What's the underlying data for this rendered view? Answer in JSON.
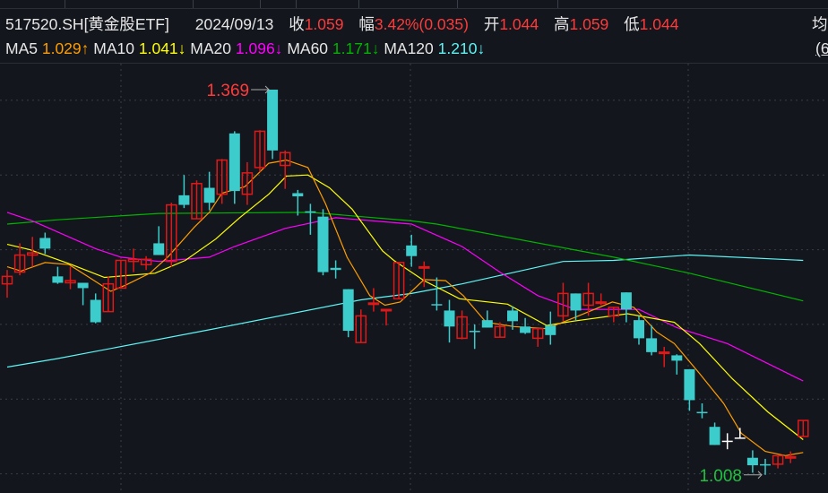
{
  "header": {
    "symbol": "517520.SH[黄金股ETF]",
    "date": "2024/09/13",
    "close_label": "收",
    "close_value": "1.059",
    "change_label": "幅",
    "change_value": "3.42%(0.035)",
    "open_label": "开",
    "open_value": "1.044",
    "high_label": "高",
    "high_value": "1.059",
    "low_label": "低",
    "low_value": "1.044",
    "avg_label_cut": "均",
    "right_cut": "(6"
  },
  "ma_legend": [
    {
      "name": "MA5",
      "value": "1.029↑",
      "color": "#ff9d00"
    },
    {
      "name": "MA10",
      "value": "1.041↓",
      "color": "#ffff00"
    },
    {
      "name": "MA20",
      "value": "1.096↓",
      "color": "#ff00ff"
    },
    {
      "name": "MA60",
      "value": "1.171↓",
      "color": "#00b400"
    },
    {
      "name": "MA120",
      "value": "1.210↓",
      "color": "#5ff5f5"
    }
  ],
  "colors": {
    "up": "#e01818",
    "down": "#3ccccc",
    "flat": "#ffffff",
    "background": "#13161c"
  },
  "chart_data": {
    "type": "candlestick",
    "title": "517520.SH 黄金股ETF daily",
    "ylim": [
      0.991,
      1.453
    ],
    "grid_prices": [
      1.359,
      1.289,
      1.219,
      1.149,
      1.079,
      1.009
    ],
    "annotations": [
      {
        "text": "1.369",
        "candle": 22,
        "price": 1.369,
        "kind": "high",
        "color": "#ff3a3a"
      },
      {
        "text": "1.008",
        "candle": 61,
        "price": 1.008,
        "kind": "low",
        "color": "#1fc040"
      }
    ],
    "candles": [
      [
        1.187,
        1.2,
        1.174,
        1.194
      ],
      [
        1.198,
        1.225,
        1.195,
        1.214
      ],
      [
        1.214,
        1.231,
        1.203,
        1.216
      ],
      [
        1.23,
        1.235,
        1.215,
        1.22
      ],
      [
        1.194,
        1.203,
        1.187,
        1.188
      ],
      [
        1.188,
        1.203,
        1.182,
        1.19
      ],
      [
        1.188,
        1.188,
        1.167,
        1.183
      ],
      [
        1.172,
        1.178,
        1.15,
        1.151
      ],
      [
        1.161,
        1.194,
        1.161,
        1.187
      ],
      [
        1.183,
        1.209,
        1.183,
        1.209
      ],
      [
        1.208,
        1.22,
        1.198,
        1.21
      ],
      [
        1.205,
        1.213,
        1.2,
        1.21
      ],
      [
        1.225,
        1.241,
        1.214,
        1.214
      ],
      [
        1.208,
        1.263,
        1.203,
        1.261
      ],
      [
        1.27,
        1.289,
        1.258,
        1.261
      ],
      [
        1.248,
        1.284,
        1.248,
        1.281
      ],
      [
        1.277,
        1.292,
        1.256,
        1.263
      ],
      [
        1.271,
        1.304,
        1.262,
        1.303
      ],
      [
        1.328,
        1.33,
        1.262,
        1.274
      ],
      [
        1.271,
        1.301,
        1.261,
        1.291
      ],
      [
        1.296,
        1.331,
        1.292,
        1.33
      ],
      [
        1.369,
        1.369,
        1.304,
        1.312
      ],
      [
        1.298,
        1.312,
        1.276,
        1.31
      ],
      [
        1.272,
        1.275,
        1.251,
        1.269
      ],
      [
        1.255,
        1.262,
        1.233,
        1.254
      ],
      [
        1.25,
        1.257,
        1.195,
        1.198
      ],
      [
        1.202,
        1.209,
        1.192,
        1.2
      ],
      [
        1.182,
        1.182,
        1.137,
        1.143
      ],
      [
        1.132,
        1.163,
        1.132,
        1.157
      ],
      [
        1.168,
        1.183,
        1.161,
        1.169
      ],
      [
        1.162,
        1.163,
        1.148,
        1.163
      ],
      [
        1.173,
        1.207,
        1.173,
        1.207
      ],
      [
        1.223,
        1.233,
        1.203,
        1.213
      ],
      [
        1.202,
        1.208,
        1.184,
        1.203
      ],
      [
        1.168,
        1.193,
        1.162,
        1.167
      ],
      [
        1.162,
        1.172,
        1.132,
        1.147
      ],
      [
        1.136,
        1.162,
        1.135,
        1.156
      ],
      [
        1.143,
        1.149,
        1.126,
        1.142
      ],
      [
        1.153,
        1.162,
        1.146,
        1.146
      ],
      [
        1.137,
        1.151,
        1.137,
        1.147
      ],
      [
        1.162,
        1.166,
        1.144,
        1.152
      ],
      [
        1.147,
        1.155,
        1.14,
        1.141
      ],
      [
        1.136,
        1.145,
        1.128,
        1.145
      ],
      [
        1.148,
        1.161,
        1.13,
        1.139
      ],
      [
        1.157,
        1.188,
        1.152,
        1.178
      ],
      [
        1.178,
        1.178,
        1.153,
        1.162
      ],
      [
        1.167,
        1.188,
        1.157,
        1.178
      ],
      [
        1.169,
        1.178,
        1.167,
        1.17
      ],
      [
        1.157,
        1.165,
        1.151,
        1.165
      ],
      [
        1.179,
        1.179,
        1.151,
        1.163
      ],
      [
        1.153,
        1.157,
        1.13,
        1.136
      ],
      [
        1.136,
        1.148,
        1.12,
        1.123
      ],
      [
        1.122,
        1.128,
        1.109,
        1.123
      ],
      [
        1.12,
        1.121,
        1.102,
        1.115
      ],
      [
        1.107,
        1.107,
        1.068,
        1.078
      ],
      [
        1.067,
        1.075,
        1.061,
        1.066
      ],
      [
        1.053,
        1.057,
        1.036,
        1.036
      ],
      [
        1.04,
        1.047,
        1.032,
        1.04
      ],
      [
        1.043,
        1.052,
        1.042,
        1.043
      ],
      [
        1.024,
        1.031,
        1.01,
        1.017
      ],
      [
        1.018,
        1.023,
        1.008,
        1.017
      ],
      [
        1.018,
        1.026,
        1.014,
        1.026
      ],
      [
        1.024,
        1.03,
        1.019,
        1.025
      ],
      [
        1.044,
        1.059,
        1.044,
        1.059
      ]
    ],
    "candle_fields": [
      "open",
      "high",
      "low",
      "close"
    ],
    "moving_averages": [
      {
        "name": "MA120",
        "color": "#5ff5f5",
        "points": [
          [
            1,
            1.109
          ],
          [
            5,
            1.117
          ],
          [
            17,
            1.144
          ],
          [
            29,
            1.172
          ],
          [
            33,
            1.178
          ],
          [
            37,
            1.187
          ],
          [
            45,
            1.208
          ],
          [
            49,
            1.209
          ],
          [
            55,
            1.214
          ],
          [
            64,
            1.209
          ]
        ]
      },
      {
        "name": "MA60",
        "color": "#00b400",
        "points": [
          [
            1,
            1.243
          ],
          [
            5,
            1.247
          ],
          [
            13,
            1.253
          ],
          [
            25,
            1.254
          ],
          [
            33,
            1.246
          ],
          [
            35,
            1.243
          ],
          [
            49,
            1.212
          ],
          [
            55,
            1.197
          ],
          [
            64,
            1.171
          ]
        ]
      },
      {
        "name": "MA20",
        "color": "#ff00ff",
        "points": [
          [
            1,
            1.254
          ],
          [
            3,
            1.246
          ],
          [
            8,
            1.22
          ],
          [
            10,
            1.212
          ],
          [
            13,
            1.208
          ],
          [
            17,
            1.212
          ],
          [
            19,
            1.222
          ],
          [
            23,
            1.239
          ],
          [
            27,
            1.249
          ],
          [
            33,
            1.243
          ],
          [
            37,
            1.222
          ],
          [
            40,
            1.198
          ],
          [
            43,
            1.176
          ],
          [
            46,
            1.163
          ],
          [
            51,
            1.163
          ],
          [
            54,
            1.146
          ],
          [
            58,
            1.131
          ],
          [
            64,
            1.096
          ]
        ]
      },
      {
        "name": "MA10",
        "color": "#ffff00",
        "points": [
          [
            1,
            1.224
          ],
          [
            2.8,
            1.219
          ],
          [
            6.1,
            1.205
          ],
          [
            8.7,
            1.193
          ],
          [
            12.7,
            1.197
          ],
          [
            15.1,
            1.209
          ],
          [
            17.5,
            1.229
          ],
          [
            19.4,
            1.249
          ],
          [
            21.7,
            1.271
          ],
          [
            23.1,
            1.288
          ],
          [
            24.8,
            1.289
          ],
          [
            26.5,
            1.277
          ],
          [
            28.3,
            1.257
          ],
          [
            30.7,
            1.218
          ],
          [
            31.6,
            1.209
          ],
          [
            34,
            1.19
          ],
          [
            36.8,
            1.173
          ],
          [
            40.6,
            1.168
          ],
          [
            43.7,
            1.148
          ],
          [
            45.8,
            1.152
          ],
          [
            50.1,
            1.159
          ],
          [
            53.8,
            1.151
          ],
          [
            55.8,
            1.131
          ],
          [
            58.4,
            1.098
          ],
          [
            61.2,
            1.067
          ],
          [
            64,
            1.041
          ]
        ]
      },
      {
        "name": "MA5",
        "color": "#ff9d00",
        "points": [
          [
            1,
            1.203
          ],
          [
            2.1,
            1.199
          ],
          [
            4,
            1.207
          ],
          [
            5.9,
            1.205
          ],
          [
            7.5,
            1.193
          ],
          [
            9.2,
            1.18
          ],
          [
            10.4,
            1.186
          ],
          [
            12.3,
            1.197
          ],
          [
            13.7,
            1.212
          ],
          [
            15.8,
            1.24
          ],
          [
            17,
            1.254
          ],
          [
            18,
            1.272
          ],
          [
            19.8,
            1.278
          ],
          [
            21.7,
            1.3
          ],
          [
            23.1,
            1.303
          ],
          [
            24.8,
            1.296
          ],
          [
            26.2,
            1.262
          ],
          [
            27.9,
            1.212
          ],
          [
            29.7,
            1.176
          ],
          [
            30.9,
            1.167
          ],
          [
            32.1,
            1.17
          ],
          [
            34,
            1.191
          ],
          [
            35.7,
            1.19
          ],
          [
            37.1,
            1.176
          ],
          [
            38.9,
            1.151
          ],
          [
            41.1,
            1.147
          ],
          [
            43.7,
            1.145
          ],
          [
            45.8,
            1.155
          ],
          [
            48.9,
            1.17
          ],
          [
            50.6,
            1.165
          ],
          [
            52.4,
            1.142
          ],
          [
            53.8,
            1.131
          ],
          [
            55.8,
            1.103
          ],
          [
            57.7,
            1.075
          ],
          [
            59.1,
            1.047
          ],
          [
            61,
            1.03
          ],
          [
            62.6,
            1.026
          ],
          [
            64,
            1.029
          ]
        ]
      }
    ]
  }
}
